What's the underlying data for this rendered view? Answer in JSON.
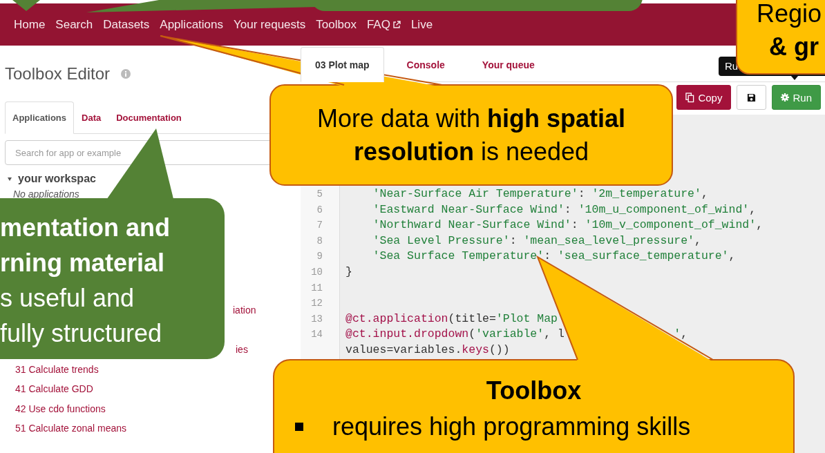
{
  "nav": {
    "items": [
      {
        "label": "Home",
        "external": false
      },
      {
        "label": "Search",
        "external": false
      },
      {
        "label": "Datasets",
        "external": false
      },
      {
        "label": "Applications",
        "external": false
      },
      {
        "label": "Your requests",
        "external": false
      },
      {
        "label": "Toolbox",
        "external": false
      },
      {
        "label": "FAQ",
        "external": true
      },
      {
        "label": "Live",
        "external": false
      }
    ]
  },
  "editor_title": "Toolbox Editor",
  "left_tabs": [
    {
      "label": "Applications",
      "selected": true
    },
    {
      "label": "Data",
      "selected": false
    },
    {
      "label": "Documentation",
      "selected": false
    }
  ],
  "search": {
    "placeholder": "Search for app or example"
  },
  "workspace": {
    "label": "your workspac",
    "expanded": true,
    "note": "No applications"
  },
  "examples": [
    {
      "text": "iation",
      "kind": "cut"
    },
    {
      "text": "ies",
      "kind": "cut"
    },
    {
      "text": "31 Calculate trends",
      "kind": "full"
    },
    {
      "text": "41 Calculate GDD",
      "kind": "full"
    },
    {
      "text": "42 Use cdo functions",
      "kind": "full"
    },
    {
      "text": "51 Calculate zonal means",
      "kind": "full"
    }
  ],
  "right_tabs": [
    {
      "label": "03 Plot map",
      "selected": true
    },
    {
      "label": "Console",
      "selected": false
    },
    {
      "label": "Your queue",
      "selected": false
    }
  ],
  "tooltip": "Ru",
  "toolbar": {
    "copy": "Copy",
    "run": "Run"
  },
  "code": [
    {
      "number": "5",
      "segments": [
        {
          "text": "    'Near-Surface Air Temperature'",
          "kind": "string"
        },
        {
          "text": ": ",
          "kind": "plain"
        },
        {
          "text": "'2m_temperature'",
          "kind": "string"
        },
        {
          "text": ",",
          "kind": "plain"
        }
      ]
    },
    {
      "number": "6",
      "segments": [
        {
          "text": "    'Eastward Near-Surface Wind'",
          "kind": "string"
        },
        {
          "text": ": ",
          "kind": "plain"
        },
        {
          "text": "'10m_u_component_of_wind'",
          "kind": "string"
        },
        {
          "text": ",",
          "kind": "plain"
        }
      ]
    },
    {
      "number": "7",
      "segments": [
        {
          "text": "    'Northward Near-Surface Wind'",
          "kind": "string"
        },
        {
          "text": ": ",
          "kind": "plain"
        },
        {
          "text": "'10m_v_component_of_wind'",
          "kind": "string"
        },
        {
          "text": ",",
          "kind": "plain"
        }
      ]
    },
    {
      "number": "8",
      "segments": [
        {
          "text": "    'Sea Level Pressure'",
          "kind": "string"
        },
        {
          "text": ": ",
          "kind": "plain"
        },
        {
          "text": "'mean_sea_level_pressure'",
          "kind": "string"
        },
        {
          "text": ",",
          "kind": "plain"
        }
      ]
    },
    {
      "number": "9",
      "segments": [
        {
          "text": "    'Sea Surface Temperature'",
          "kind": "string"
        },
        {
          "text": ": ",
          "kind": "plain"
        },
        {
          "text": "'sea_surface_temperature'",
          "kind": "string"
        },
        {
          "text": ",",
          "kind": "plain"
        }
      ]
    },
    {
      "number": "10",
      "segments": [
        {
          "text": "}",
          "kind": "plain"
        }
      ]
    },
    {
      "number": "11"
    },
    {
      "number": "12"
    },
    {
      "number": "13",
      "segments": [
        {
          "text": "@ct.application",
          "kind": "decorator"
        },
        {
          "text": "(title=",
          "kind": "plain"
        },
        {
          "text": "'Plot Map",
          "kind": "string"
        }
      ]
    },
    {
      "number": "14",
      "segments": [
        {
          "text": "@ct.input.dropdown",
          "kind": "decorator"
        },
        {
          "text": "(",
          "kind": "plain"
        },
        {
          "text": "'variable'",
          "kind": "string"
        },
        {
          "text": ", l",
          "kind": "plain"
        },
        {
          "text": "'",
          "kind": "string",
          "covered_before": true
        },
        {
          "text": ",",
          "kind": "plain"
        }
      ]
    },
    {
      "segments": [
        {
          "text": "values=variables.",
          "kind": "plain"
        },
        {
          "text": "keys",
          "kind": "decorator"
        },
        {
          "text": "())",
          "kind": "plain"
        }
      ]
    }
  ],
  "callouts": [
    {
      "kind": "green-top"
    },
    {
      "kind": "yellow-corner",
      "lines": [
        {
          "text": "Regio",
          "bold": false
        },
        {
          "text": "& gr",
          "bold": true
        }
      ]
    },
    {
      "kind": "yellow-middle",
      "text": "More data with **high spatial resolution** is needed"
    },
    {
      "kind": "green-left",
      "lines": [
        {
          "text": "mentation and",
          "bold": true
        },
        {
          "text": "rning material",
          "bold": true
        },
        {
          "text": "s useful and",
          "bold": false
        },
        {
          "text": "fully structured",
          "bold": false
        }
      ]
    },
    {
      "kind": "yellow-bottom",
      "title": "Toolbox",
      "bullets": [
        "requires high programming skills"
      ]
    }
  ]
}
